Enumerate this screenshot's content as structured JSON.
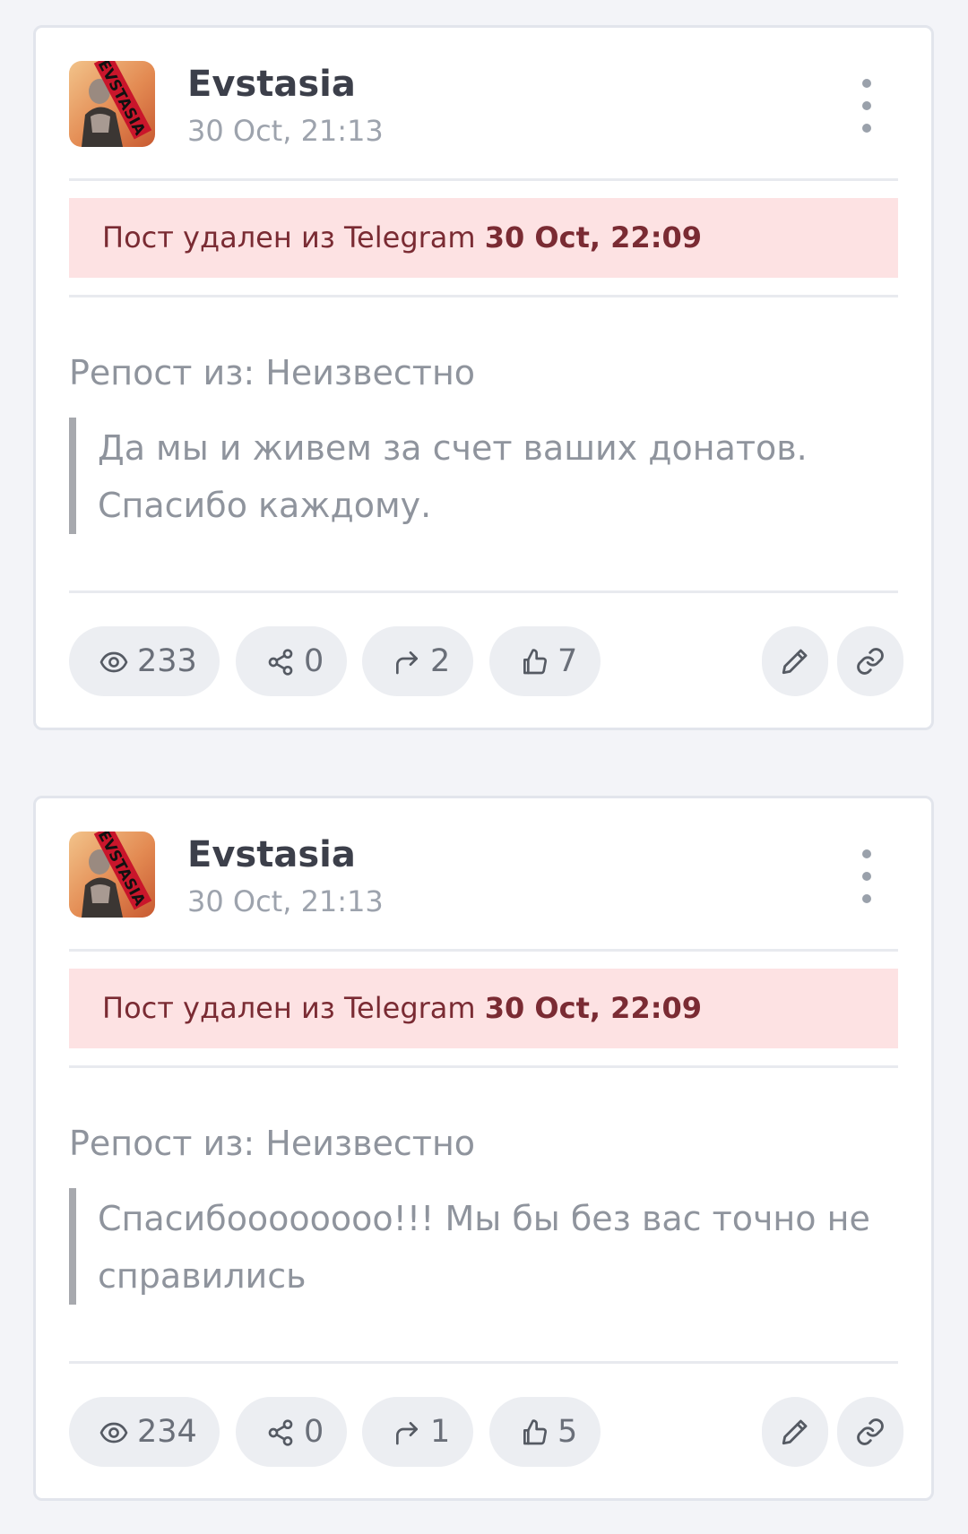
{
  "posts": [
    {
      "author": "Evstasia",
      "date": "30 Oct, 21:13",
      "deleted_text": "Пост удален из Telegram",
      "deleted_date": "30 Oct, 22:09",
      "repost_label": "Репост из: Неизвестно",
      "quote": "Да мы и живем за счет ваших донатов. Спасибо каждому.",
      "stats": {
        "views": "233",
        "shares": "0",
        "reposts": "2",
        "likes": "7"
      }
    },
    {
      "author": "Evstasia",
      "date": "30 Oct, 21:13",
      "deleted_text": "Пост удален из Telegram",
      "deleted_date": "30 Oct, 22:09",
      "repost_label": "Репост из: Неизвестно",
      "quote": "Спасибоооооооо!!! Мы бы без вас точно не справились",
      "stats": {
        "views": "234",
        "shares": "0",
        "reposts": "1",
        "likes": "5"
      }
    }
  ],
  "avatar_text": "EVSTASIA",
  "icons": {
    "views": "eye-icon",
    "shares": "share-nodes-icon",
    "reposts": "forward-arrow-icon",
    "likes": "thumbs-up-icon",
    "edit": "pencil-icon",
    "link": "link-icon",
    "menu": "kebab-menu-icon"
  },
  "colors": {
    "page_background": "#f3f4f8",
    "banner_background": "#fde2e3",
    "banner_text": "#7a2b33",
    "pill_background": "#eceef2"
  }
}
